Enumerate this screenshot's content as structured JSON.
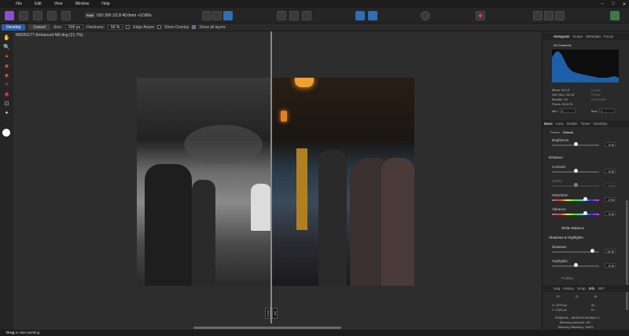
{
  "menu": [
    "File",
    "Edit",
    "View",
    "Window",
    "Help"
  ],
  "toolbar": {
    "raw_badge": "RAW",
    "exif": "ISO 200 1/2.8 40.0mm +1/160s"
  },
  "context": {
    "develop": "Develop",
    "cancel": "Cancel",
    "size_label": "Size:",
    "size_value": "500 px",
    "hardness_label": "Hardness:",
    "hardness_value": "50 %",
    "edge_aware": "Edge Aware",
    "show_overlay": "Show Overlay",
    "show_all_layers": "Show all layers"
  },
  "document": {
    "title": "IMGR1177-Enhanced-NR.dng (21.7%)",
    "before_label": "Before",
    "after_label": "After"
  },
  "panel": {
    "top_tabs": [
      "Histogram",
      "Scope",
      "Metadata",
      "Focus"
    ],
    "channels": "All Channels",
    "stats": {
      "mean": "Mean: 52.13",
      "stddev": "Std. Dev.: 53.19",
      "median": "Median: 30",
      "pixels": "Pixels: 310176",
      "levels": "Levels:",
      "pixels_right": "Pixels:",
      "percentile": "Percentile:"
    },
    "min_label": "Min:",
    "min_value": "0",
    "max_label": "Max:",
    "max_value": "1",
    "dev_tabs": [
      "Basic",
      "Lens",
      "Details",
      "Tones",
      "Overlays"
    ],
    "preset_label": "Preset:",
    "preset_value": "Default",
    "brightness_label": "Brightness",
    "brightness_value": "0 %",
    "enhance_label": "Enhance",
    "contrast_label": "Contrast",
    "contrast_value": "0 %",
    "clarity_label": "Clarity",
    "clarity_value": "0 %",
    "saturation_label": "Saturation",
    "saturation_value": "0 %",
    "vibrance_label": "Vibrance",
    "vibrance_value": "0 %",
    "white_balance_label": "White Balance",
    "shadows_highlights_label": "Shadows & Highlights",
    "shadows_label": "Shadows",
    "shadows_value": "70 %",
    "highlights_label": "Highlights",
    "highlights_value": "0 %",
    "profiles_label": "Profiles",
    "bottom_tabs": [
      "Nag",
      "History",
      "Snap",
      "Info",
      "32P"
    ],
    "info": {
      "r": "R:",
      "g": "G:",
      "b": "B:",
      "x": "X: 1975 px",
      "y": "Y: 2104 px",
      "w": "W: -",
      "h": "H: -",
      "profile": "RGBA/16 - sRGB IEC61966-2.1",
      "memory_pressure": "Memory pressure: 9%",
      "memory_efficiency": "Memory efficiency: 440%"
    }
  },
  "status": {
    "hint_bold": "Drag",
    "hint_rest": "to start painting."
  }
}
